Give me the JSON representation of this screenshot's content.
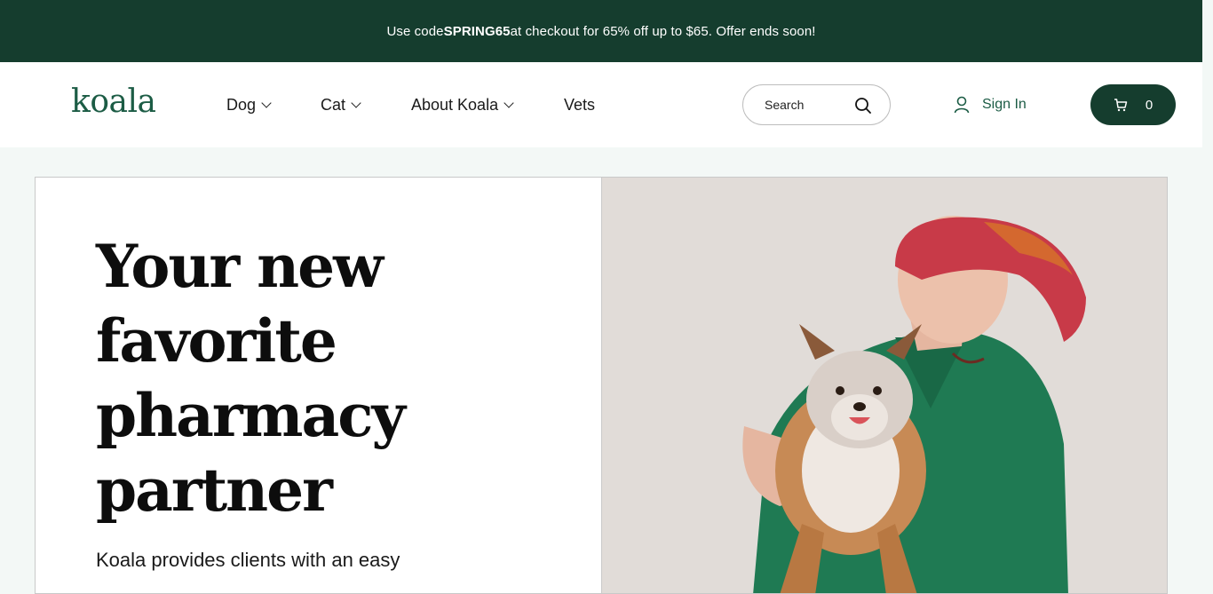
{
  "promo": {
    "prefix": "Use code ",
    "code": "SPRING65",
    "suffix": " at checkout for 65% off up to $65. Offer ends soon!"
  },
  "header": {
    "logo": "koala",
    "nav": [
      {
        "label": "Dog",
        "has_dropdown": true
      },
      {
        "label": "Cat",
        "has_dropdown": true
      },
      {
        "label": "About Koala",
        "has_dropdown": true
      },
      {
        "label": "Vets",
        "has_dropdown": false
      }
    ],
    "search_placeholder": "Search",
    "signin_label": "Sign In",
    "cart_count": "0"
  },
  "hero": {
    "title_lines": [
      "Your new",
      "favorite",
      "pharmacy",
      "partner"
    ],
    "subtitle": "Koala provides clients with an easy"
  },
  "colors": {
    "brand_dark": "#153d2e",
    "brand_green": "#1c5c45",
    "page_bg": "#f3f8f6",
    "scrubs_green": "#1f7a53"
  },
  "icons": [
    "chevron-down-icon",
    "search-icon",
    "user-icon",
    "cart-icon"
  ]
}
